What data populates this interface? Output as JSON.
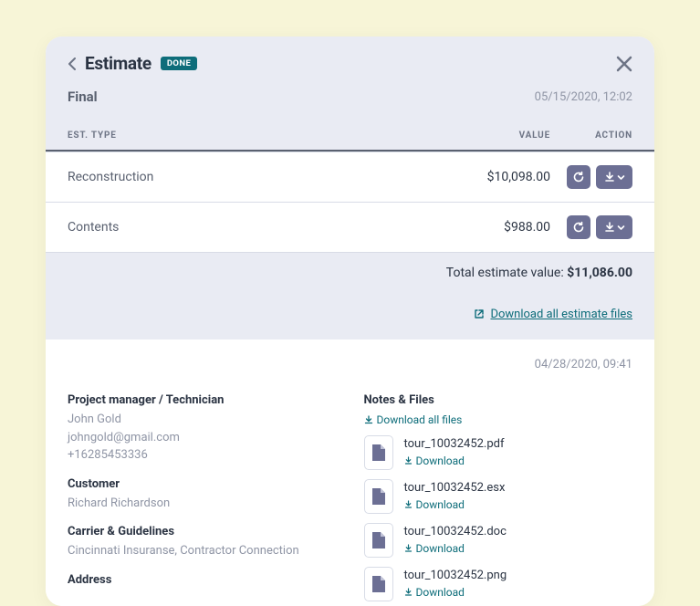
{
  "header": {
    "title": "Estimate",
    "badge": "DONE",
    "subtitle": "Final",
    "timestamp": "05/15/2020, 12:02"
  },
  "table": {
    "columns": {
      "type": "EST. TYPE",
      "value": "VALUE",
      "action": "ACTION"
    },
    "rows": [
      {
        "name": "Reconstruction",
        "value": "$10,098.00"
      },
      {
        "name": "Contents",
        "value": "$988.00"
      }
    ],
    "total_label": "Total estimate value:",
    "total_value": "$11,086.00",
    "download_all_label": "Download all estimate files"
  },
  "bottom": {
    "timestamp": "04/28/2020, 09:41",
    "pm_label": "Project manager / Technician",
    "pm_name": "John Gold",
    "pm_email": "johngold@gmail.com",
    "pm_phone": "+16285453336",
    "customer_label": "Customer",
    "customer_name": "Richard Richardson",
    "carrier_label": "Carrier & Guidelines",
    "carrier_value": "Cincinnati Insuranse, Contractor Connection",
    "address_label": "Address",
    "notes_label": "Notes & Files",
    "download_all_files_label": "Download all files",
    "download_label": "Download",
    "files": [
      {
        "name": "tour_10032452.pdf"
      },
      {
        "name": "tour_10032452.esx"
      },
      {
        "name": "tour_10032452.doc"
      },
      {
        "name": "tour_10032452.png"
      }
    ]
  }
}
